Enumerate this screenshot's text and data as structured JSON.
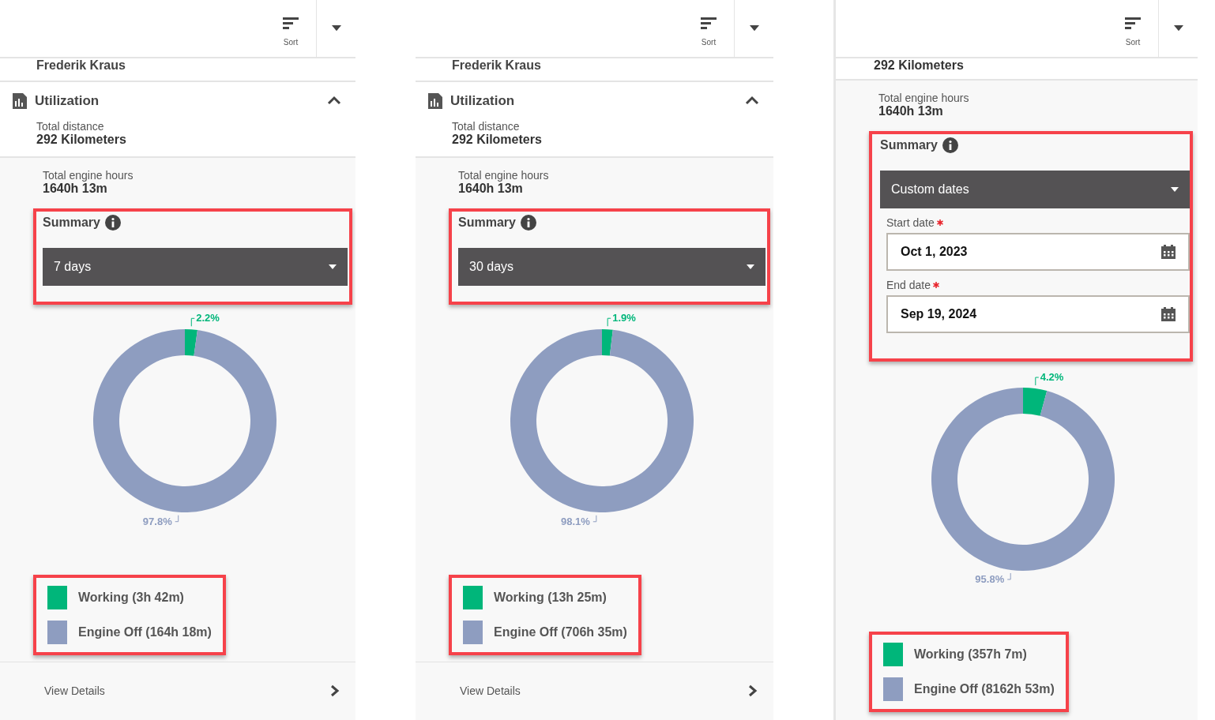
{
  "panels": [
    {
      "sort_label": "Sort",
      "driver": "Frederik Kraus",
      "section": {
        "title": "Utilization",
        "expanded": true
      },
      "distance": {
        "label": "Total distance",
        "value": "292 Kilometers"
      },
      "engine_hours": {
        "label": "Total engine hours",
        "value": "1640h 13m"
      },
      "summary": {
        "title": "Summary",
        "period": "7 days",
        "highlighted": true
      },
      "chart_data": {
        "type": "donut",
        "values": [
          2.2,
          97.8
        ],
        "data_labels": true,
        "value_labels": [
          "2.2%",
          "97.8%"
        ]
      },
      "legend": {
        "highlighted": true,
        "items": [
          {
            "label": "Working (3h 42m)",
            "color": "#00b67a"
          },
          {
            "label": "Engine Off (164h 18m)",
            "color": "#8e9dc0"
          }
        ]
      },
      "footer_link": "View Details"
    },
    {
      "sort_label": "Sort",
      "driver": "Frederik Kraus",
      "section": {
        "title": "Utilization",
        "expanded": true
      },
      "distance": {
        "label": "Total distance",
        "value": "292 Kilometers"
      },
      "engine_hours": {
        "label": "Total engine hours",
        "value": "1640h 13m"
      },
      "summary": {
        "title": "Summary",
        "period": "30 days",
        "highlighted": true
      },
      "chart_data": {
        "type": "donut",
        "values": [
          1.9,
          98.1
        ],
        "data_labels": true,
        "value_labels": [
          "1.9%",
          "98.1%"
        ]
      },
      "legend": {
        "highlighted": true,
        "items": [
          {
            "label": "Working (13h 25m)",
            "color": "#00b67a"
          },
          {
            "label": "Engine Off (706h 35m)",
            "color": "#8e9dc0"
          }
        ]
      },
      "footer_link": "View Details"
    },
    {
      "sort_label": "Sort",
      "distance": {
        "value": "292 Kilometers"
      },
      "engine_hours": {
        "label": "Total engine hours",
        "value": "1640h 13m"
      },
      "summary": {
        "title": "Summary",
        "period": "Custom dates",
        "highlighted": true,
        "date_fields": [
          {
            "label": "Start date",
            "required": true,
            "value": "Oct 1, 2023"
          },
          {
            "label": "End date",
            "required": true,
            "value": "Sep 19, 2024"
          }
        ]
      },
      "chart_data": {
        "type": "donut",
        "values": [
          4.2,
          95.8
        ],
        "data_labels": true,
        "value_labels": [
          "4.2%",
          "95.8%"
        ]
      },
      "legend": {
        "highlighted": true,
        "items": [
          {
            "label": "Working (357h 7m)",
            "color": "#00b67a"
          },
          {
            "label": "Engine Off (8162h 53m)",
            "color": "#8e9dc0"
          }
        ]
      }
    }
  ]
}
